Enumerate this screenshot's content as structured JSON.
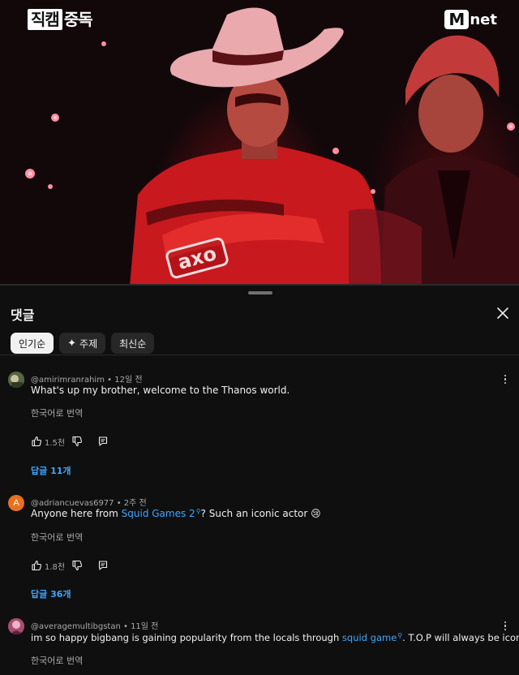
{
  "video": {
    "channel_mark": {
      "boxed": "직캠",
      "plain": "중독"
    },
    "network_mark": {
      "m": "M",
      "text": "net"
    },
    "suit_text": "axo"
  },
  "sheet": {
    "title": "댓글",
    "close_icon": "close-icon",
    "chips": [
      {
        "label": "인기순",
        "active": true
      },
      {
        "label": "주제",
        "icon": "sparkle-icon",
        "active": false
      },
      {
        "label": "최신순",
        "active": false
      }
    ]
  },
  "comments": [
    {
      "author": "@amirimranrahim",
      "time": "12일 전",
      "text_parts": [
        "What's up my brother, welcome to the Thanos world."
      ],
      "translate": "한국어로 번역",
      "likes": "1.5천",
      "replies": "답글 11개",
      "avatar_color": "#6b7d4c"
    },
    {
      "author": "@adriancuevas6977",
      "time": "2주 전",
      "text_before": "Anyone here from ",
      "link": "Squid Games 2",
      "text_after": "? Such an iconic actor 😢",
      "translate": "한국어로 번역",
      "likes": "1.8천",
      "replies": "답글 36개",
      "avatar_letter": "A",
      "avatar_color": "#e8711f"
    },
    {
      "author": "@averagemultibgstan",
      "time": "11일 전",
      "text_before": "im so happy bigbang is gaining popularity from the locals through ",
      "link": "squid game",
      "text_after": ". T.O.P will always be iconic.",
      "translate": "한국어로 번역",
      "avatar_color": "#b65a78"
    }
  ],
  "colors": {
    "background": "#0f0f0f",
    "link": "#3ea6ff",
    "muted": "#aaaaaa",
    "chip": "#272727"
  }
}
